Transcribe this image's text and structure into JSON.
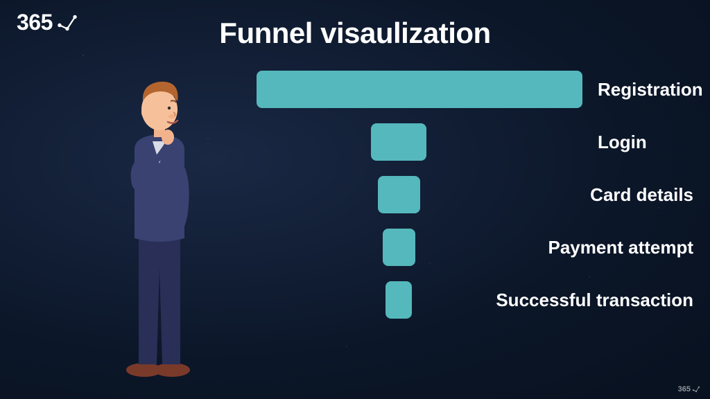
{
  "brand": {
    "name": "365"
  },
  "title": "Funnel visaulization",
  "colors": {
    "bar": "#55b8bd",
    "text": "#ffffff"
  },
  "chart_data": {
    "type": "bar",
    "title": "Funnel visaulization",
    "orientation": "horizontal-funnel",
    "categories": [
      "Registration",
      "Login",
      "Card details",
      "Payment attempt",
      "Successful transaction"
    ],
    "values": [
      100,
      17,
      13,
      10,
      8
    ],
    "note": "Values are relative bar widths as percentages of the widest (Registration) step, estimated visually; no numeric axis shown."
  }
}
